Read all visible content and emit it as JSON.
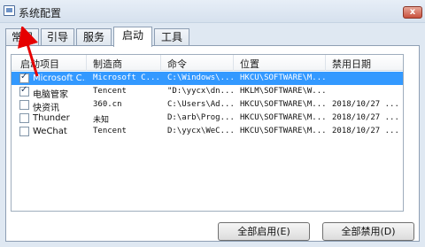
{
  "window": {
    "title": "系统配置",
    "close_label": "x"
  },
  "tabs": [
    {
      "label": "常规"
    },
    {
      "label": "引导"
    },
    {
      "label": "服务"
    },
    {
      "label": "启动"
    },
    {
      "label": "工具"
    }
  ],
  "startup_list": {
    "columns": [
      "启动项目",
      "制造商",
      "命令",
      "位置",
      "禁用日期"
    ],
    "rows": [
      {
        "item": "Microsoft C...",
        "maker": "Microsoft C...",
        "command": "C:\\Windows\\...",
        "location": "HKCU\\SOFTWARE\\M...",
        "date": "",
        "checked": true,
        "selected": true
      },
      {
        "item": "电脑管家",
        "maker": "Tencent",
        "command": "\"D:\\yycx\\dn...",
        "location": "HKLM\\SOFTWARE\\W...",
        "date": "",
        "checked": true,
        "selected": false
      },
      {
        "item": "快资讯",
        "maker": "360.cn",
        "command": "C:\\Users\\Ad...",
        "location": "HKCU\\SOFTWARE\\M...",
        "date": "2018/10/27 ...",
        "checked": false,
        "selected": false
      },
      {
        "item": "Thunder",
        "maker": "未知",
        "command": "D:\\arb\\Prog...",
        "location": "HKCU\\SOFTWARE\\M...",
        "date": "2018/10/27 ...",
        "checked": false,
        "selected": false
      },
      {
        "item": "WeChat",
        "maker": "Tencent",
        "command": "D:\\yycx\\WeC...",
        "location": "HKCU\\SOFTWARE\\M...",
        "date": "2018/10/27 ...",
        "checked": false,
        "selected": false
      }
    ]
  },
  "buttons": {
    "enable_all": "全部启用(E)",
    "disable_all": "全部禁用(D)"
  },
  "colors": {
    "selection": "#3399ff",
    "annotation_arrow": "#e60000"
  }
}
